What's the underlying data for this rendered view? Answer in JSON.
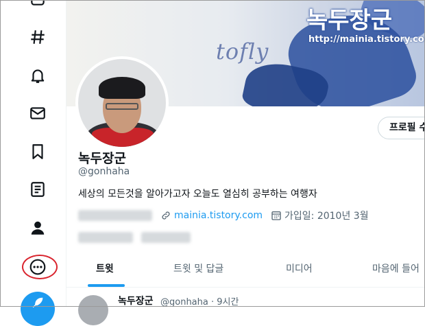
{
  "nav": {
    "items": [
      {
        "icon": "home-icon"
      },
      {
        "icon": "hashtag-icon"
      },
      {
        "icon": "bell-icon"
      },
      {
        "icon": "mail-icon"
      },
      {
        "icon": "bookmark-icon"
      },
      {
        "icon": "list-icon"
      },
      {
        "icon": "profile-icon"
      },
      {
        "icon": "more-icon"
      }
    ],
    "highlight_color": "#d9232d",
    "tweet_button_icon": "feather-icon"
  },
  "banner": {
    "title": "녹두장군",
    "url": "http://mainia.tistory.com",
    "script_text": "tofly"
  },
  "profile": {
    "edit_button": "프로필 수",
    "name": "녹두장군",
    "handle": "@gonhaha",
    "bio": "세상의 모든것을 알아가고자 오늘도 열심히 공부하는 여행자",
    "website": "mainia.tistory.com",
    "joined": "가입일: 2010년 3월"
  },
  "tabs": [
    {
      "label": "트윗"
    },
    {
      "label": "트윗 및 답글"
    },
    {
      "label": "미디어"
    },
    {
      "label": "마음에 들어"
    }
  ],
  "tweet": {
    "name": "녹두장군",
    "meta": "@gonhaha · 9시간"
  },
  "colors": {
    "accent": "#1d9bf0",
    "text": "#0f1419",
    "muted": "#536471"
  }
}
